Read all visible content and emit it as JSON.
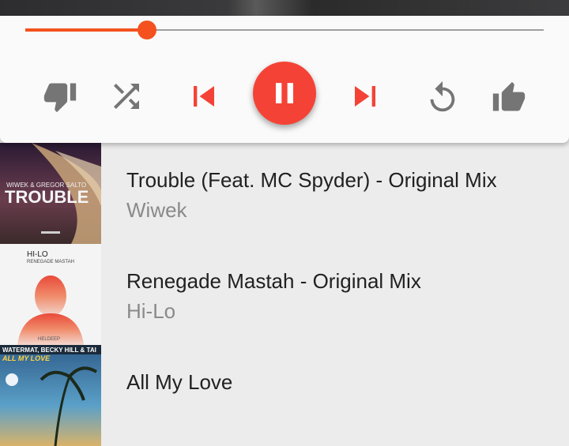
{
  "player": {
    "progress": 0.235,
    "accent_color": "#f4511e",
    "play_state": "playing",
    "buttons": {
      "thumbs_down": "thumbs-down-icon",
      "shuffle": "shuffle-icon",
      "previous": "skip-previous-icon",
      "pause": "pause-icon",
      "next": "skip-next-icon",
      "repeat": "repeat-icon",
      "thumbs_up": "thumbs-up-icon"
    }
  },
  "queue": [
    {
      "title": "Trouble (Feat. MC Spyder) - Original Mix",
      "artist": "Wiwek",
      "art": {
        "top_text": "WIWEK & GREGOR SALTO",
        "main_text": "TROUBLE"
      }
    },
    {
      "title": "Renegade Mastah - Original Mix",
      "artist": "Hi-Lo",
      "art": {
        "top_text": "HI-LO",
        "sub_text": "RENEGADE MASTAH",
        "bottom_text": "HELDEEP"
      }
    },
    {
      "title": "All My Love",
      "artist": "",
      "art": {
        "top_text": "WATERMAT, BECKY HILL & TAI",
        "main_text": "ALL MY LOVE"
      }
    }
  ]
}
